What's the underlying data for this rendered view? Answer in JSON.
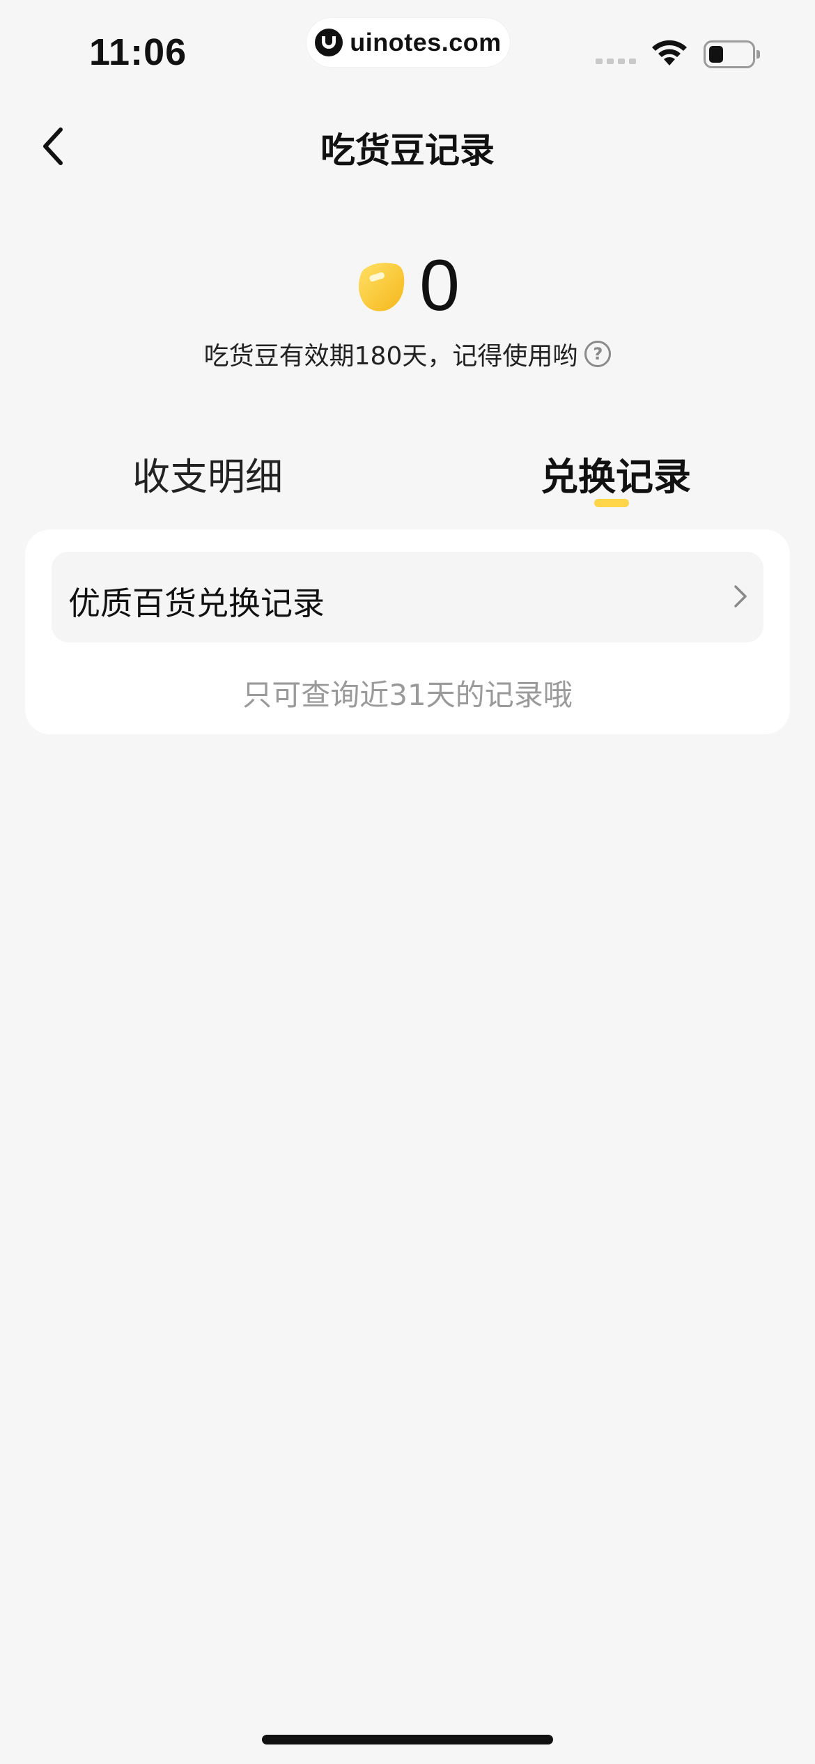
{
  "status_bar": {
    "time": "11:06",
    "watermark": "uinotes.com"
  },
  "nav": {
    "title": "吃货豆记录",
    "back_icon": "chevron-left-icon"
  },
  "balance": {
    "icon": "bean-icon",
    "value": "0",
    "validity_note": "吃货豆有效期180天，记得使用哟",
    "help_icon_glyph": "?"
  },
  "tabs": {
    "items": [
      {
        "label": "收支明细",
        "active": false
      },
      {
        "label": "兑换记录",
        "active": true
      }
    ],
    "indicator_color": "#ffd54a"
  },
  "records": {
    "row_label": "优质百货兑换记录",
    "hint": "只可查询近31天的记录哦"
  },
  "colors": {
    "background": "#f6f6f6",
    "card": "#ffffff",
    "accent": "#ffd54a",
    "hint_text": "#9a9a9a"
  }
}
